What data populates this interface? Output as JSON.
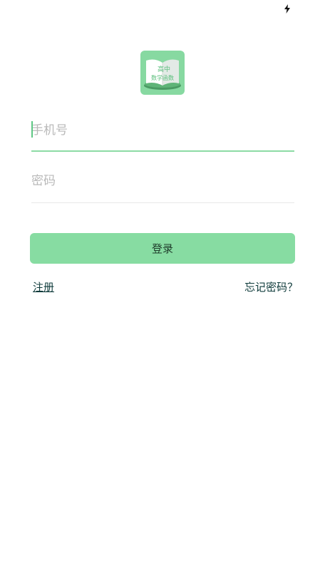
{
  "status_bar": {
    "charging_icon": "lightning-bolt-icon"
  },
  "logo": {
    "line1": "高中",
    "line2": "数学函数",
    "background_color": "#87d9a1"
  },
  "form": {
    "phone_placeholder": "手机号",
    "password_placeholder": "密码",
    "login_label": "登录"
  },
  "links": {
    "register_label": "注册",
    "forgot_password_label": "忘记密码？"
  },
  "colors": {
    "accent": "#87dca2",
    "link": "#0f3b3b"
  }
}
